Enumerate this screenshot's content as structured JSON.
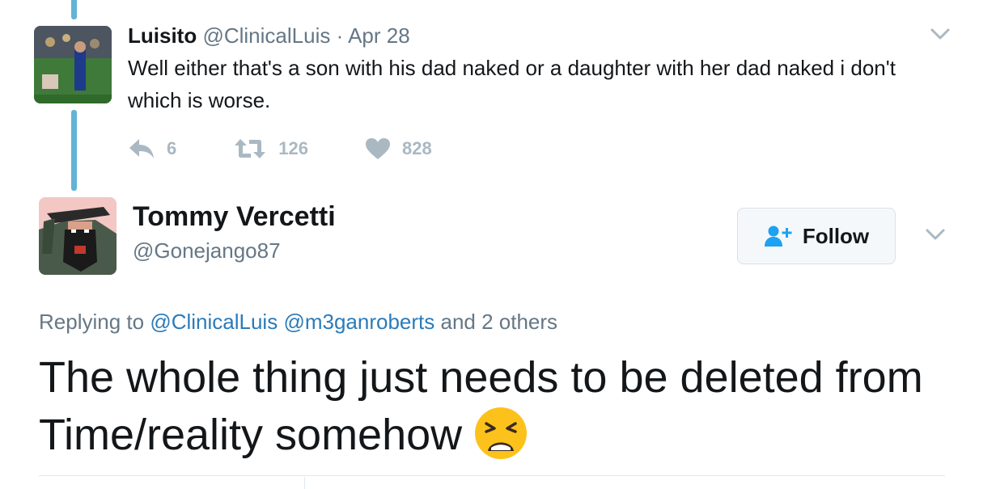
{
  "parent_tweet": {
    "author_name": "Luisito",
    "author_handle": "@ClinicalLuis",
    "separator": "·",
    "date": "Apr 28",
    "text": "Well either that's a son with his dad naked or a daughter with her dad naked i don't which is worse.",
    "reply_count": "6",
    "retweet_count": "126",
    "like_count": "828"
  },
  "main_tweet": {
    "author_name": "Tommy Vercetti",
    "author_handle": "@Gonejango87",
    "follow_label": "Follow",
    "replying_prefix": "Replying to",
    "mention_1": "@ClinicalLuis",
    "mention_2": "@m3ganroberts",
    "replying_suffix": "and 2 others",
    "text": "The whole thing just needs to be deleted from Time/reality somehow",
    "emoji": "tired-face-emoji"
  },
  "colors": {
    "thread_line": "#62b3d6",
    "secondary_text": "#657786",
    "action_icon": "#aab8c2",
    "link": "#2b7bb9",
    "follow_icon": "#1da1f2"
  }
}
